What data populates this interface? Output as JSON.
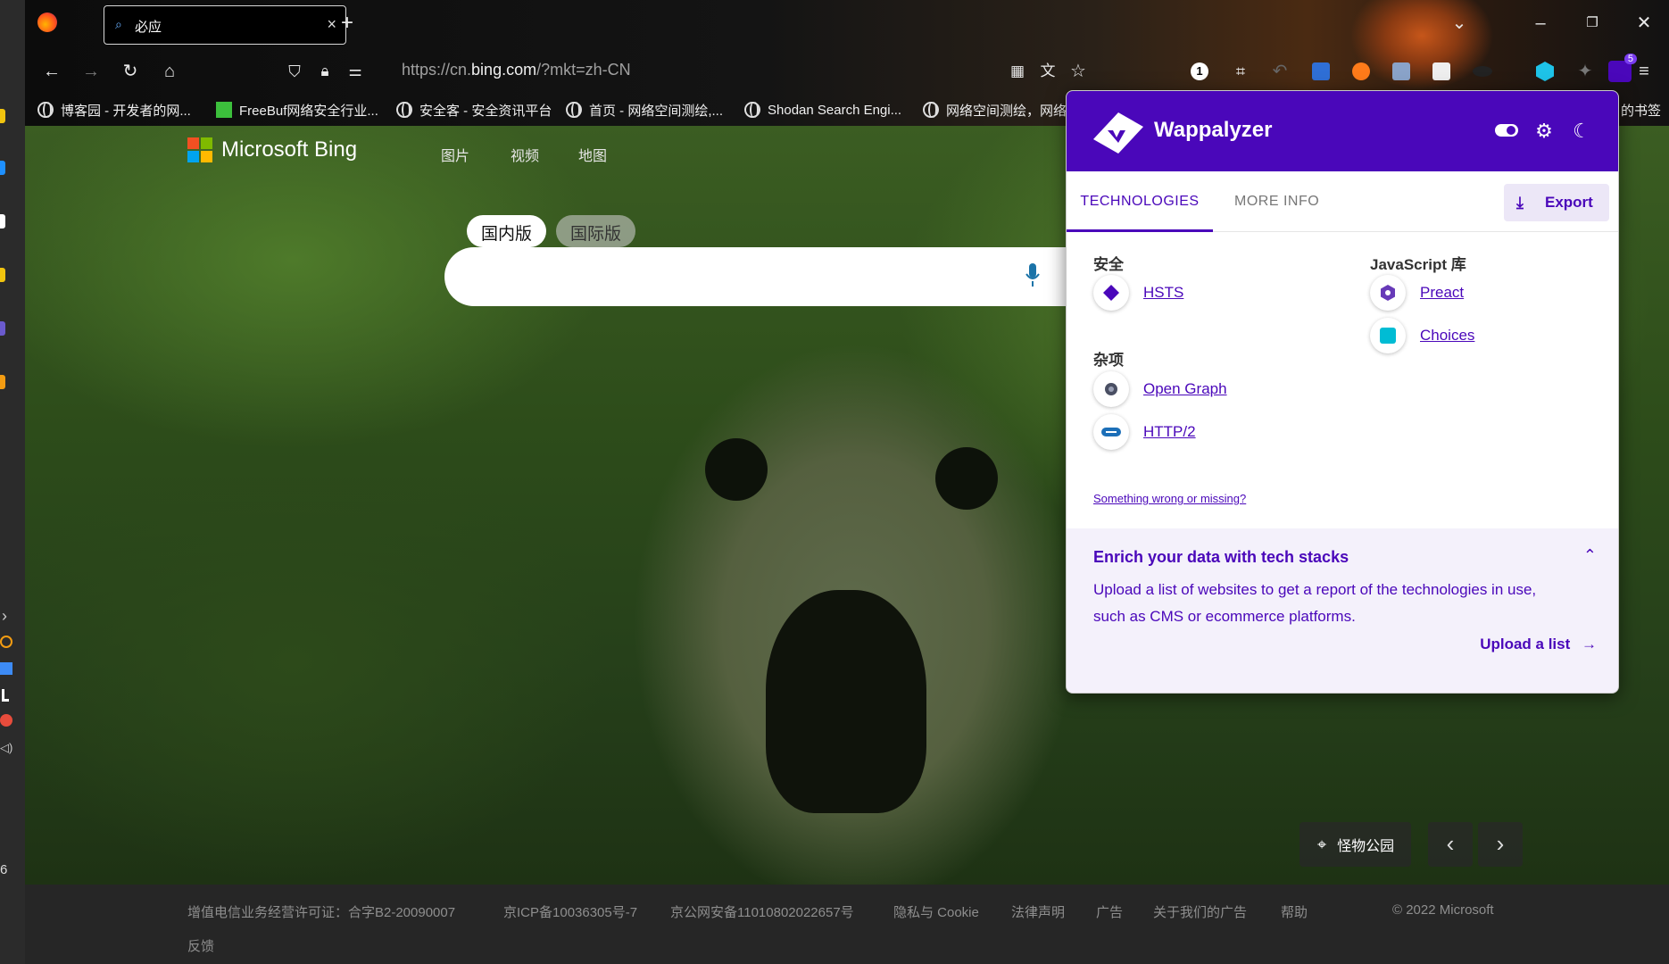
{
  "browser": {
    "tab_title": "必应",
    "url_prefix": "https://cn.",
    "url_domain": "bing.com",
    "url_suffix": "/?mkt=zh-CN",
    "badge_count": "1",
    "ext_badge_count": "5",
    "bookmarks": [
      "博客园 - 开发者的网...",
      "FreeBuf网络安全行业...",
      "安全客 - 安全资讯平台",
      "首页 - 网络空间测绘,...",
      "Shodan Search Engi...",
      "网络空间测绘，网络"
    ],
    "bookmarks_overflow": "的书签"
  },
  "bing": {
    "logo_text": "Microsoft Bing",
    "nav": [
      "图片",
      "视频",
      "地图"
    ],
    "region_tabs": [
      "国内版",
      "国际版"
    ],
    "location": "怪物公园",
    "footer_links": [
      "增值电信业务经营许可证：合字B2-20090007",
      "京ICP备10036305号-7",
      "京公网安备11010802022657号",
      "隐私与 Cookie",
      "法律声明",
      "广告",
      "关于我们的广告",
      "帮助",
      "© 2022 Microsoft",
      "反馈"
    ]
  },
  "wappalyzer": {
    "name": "Wappalyzer",
    "tabs": [
      "TECHNOLOGIES",
      "MORE INFO"
    ],
    "export_label": "Export",
    "categories": [
      {
        "name": "安全",
        "techs": [
          "HSTS"
        ]
      },
      {
        "name": "杂项",
        "techs": [
          "Open Graph",
          "HTTP/2"
        ]
      },
      {
        "name": "JavaScript 库",
        "techs": [
          "Preact",
          "Choices"
        ]
      }
    ],
    "something_wrong": "Something wrong or missing?",
    "enrich_title": "Enrich your data with tech stacks",
    "enrich_text": "Upload a list of websites to get a report of the technologies in use, such as CMS or ecommerce platforms.",
    "upload_label": "Upload a list",
    "colors": {
      "brand": "#4a07ba",
      "choices": "#00bcd4"
    }
  },
  "taskbar_text": "6"
}
